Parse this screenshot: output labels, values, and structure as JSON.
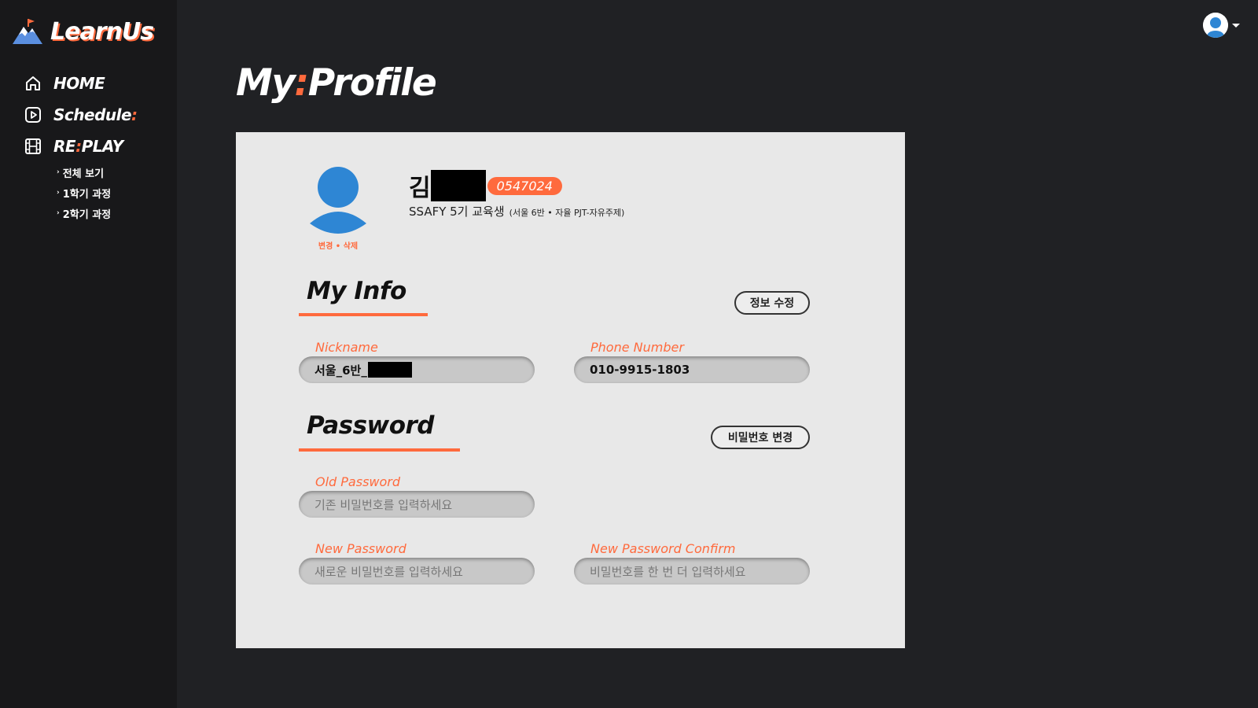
{
  "app": {
    "logo_text": "LearnUs",
    "accent_color": "#ff6a3d"
  },
  "sidebar": {
    "items": [
      {
        "label_pre": "HOME",
        "colon": "",
        "label_post": "",
        "icon": "home-icon"
      },
      {
        "label_pre": "Schedule",
        "colon": ":",
        "label_post": "",
        "icon": "play-icon"
      },
      {
        "label_pre": "RE",
        "colon": ":",
        "label_post": "PLAY",
        "icon": "film-icon"
      }
    ],
    "replay_sub": [
      {
        "label": "전체 보기"
      },
      {
        "label": "1학기 과정"
      },
      {
        "label": "2학기 과정"
      }
    ]
  },
  "header": {
    "user_icon": "user-avatar-icon"
  },
  "page": {
    "title_pre": "My",
    "title_colon": ":",
    "title_post": "Profile"
  },
  "profile": {
    "avatar_edit": "변경 • 삭제",
    "name": "김",
    "student_id": "0547024",
    "role": "SSAFY 5기 교육생",
    "role_detail": "(서울 6반 • 자율 PJT-자유주제)"
  },
  "my_info": {
    "title": "My Info",
    "edit_button": "정보 수정",
    "nickname_label": "Nickname",
    "nickname_value": "서울_6반_",
    "phone_label": "Phone Number",
    "phone_value": "010-9915-1803"
  },
  "password": {
    "title": "Password",
    "change_button": "비밀번호 변경",
    "old_label": "Old Password",
    "old_placeholder": "기존 비밀번호를 입력하세요",
    "new_label": "New Password",
    "new_placeholder": "새로운 비밀번호를 입력하세요",
    "confirm_label": "New Password Confirm",
    "confirm_placeholder": "비밀번호를 한 번 더 입력하세요"
  }
}
